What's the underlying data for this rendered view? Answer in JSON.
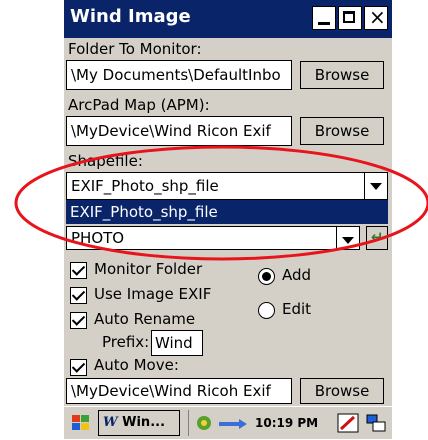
{
  "window": {
    "title": "Wind Image"
  },
  "folder": {
    "label": "Folder To Monitor:",
    "value": "\\My Documents\\DefaultInbo",
    "browse": "Browse"
  },
  "arcpad": {
    "label": "ArcPad Map (APM):",
    "value": "\\MyDevice\\Wind Ricon Exif",
    "browse": "Browse"
  },
  "shapefile": {
    "label": "Shapefile:",
    "selected": "EXIF_Photo_shp_file",
    "dropdown_highlight": "EXIF_Photo_shp_file"
  },
  "layer": {
    "selected": "PHOTO"
  },
  "options": {
    "monitor_folder": {
      "label": "Monitor Folder",
      "checked": true
    },
    "use_image_exif": {
      "label": "Use Image EXIF",
      "checked": true
    },
    "auto_rename": {
      "label": "Auto Rename",
      "checked": true
    },
    "prefix_label": "Prefix:",
    "prefix_value": "Wind",
    "auto_move": {
      "label": "Auto Move:",
      "checked": true
    }
  },
  "mode": {
    "add_label": "Add",
    "edit_label": "Edit",
    "selected": "Add"
  },
  "move_dest": {
    "value": "\\MyDevice\\Wind Ricoh Exif",
    "browse": "Browse"
  },
  "taskbar": {
    "app_button": "Win...",
    "clock": "10:19 PM"
  },
  "annotation": {
    "color": "#e8141c"
  }
}
